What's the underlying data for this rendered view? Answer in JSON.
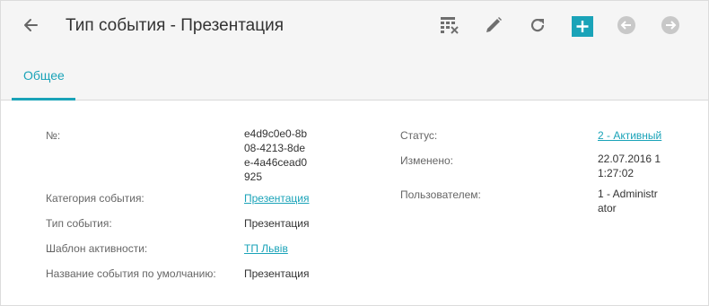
{
  "header": {
    "title": "Тип события - Презентация"
  },
  "toolbar": {
    "icons": [
      "table-clear-icon",
      "pencil-icon",
      "refresh-icon",
      "plus-icon",
      "arrow-left-circle-icon",
      "arrow-right-circle-icon"
    ],
    "accent": "#1aa3b8"
  },
  "tabs": [
    {
      "label": "Общее",
      "active": true
    }
  ],
  "left_fields": [
    {
      "label": "№:",
      "value_lines": [
        "e4d9c0e0-8b",
        "08-4213-8de",
        "e-4a46cead0",
        "925"
      ]
    },
    {
      "label": "Категория события:",
      "value": "Презентация",
      "is_link": true
    },
    {
      "label": "Тип события:",
      "value": "Презентация",
      "is_link": false
    },
    {
      "label": "Шаблон активности:",
      "value": "ТП Львів",
      "is_link": true
    },
    {
      "label": "Название события по умолчанию:",
      "value": "Презентация",
      "is_link": false
    }
  ],
  "right_fields": [
    {
      "label": "Статус:",
      "value": "2 - Активный",
      "is_link": true
    },
    {
      "label": "Изменено:",
      "value_lines": [
        "22.07.2016 1",
        "1:27:02"
      ]
    },
    {
      "label": "Пользователем:",
      "value_lines": [
        "1 - Administr",
        "ator"
      ]
    }
  ]
}
